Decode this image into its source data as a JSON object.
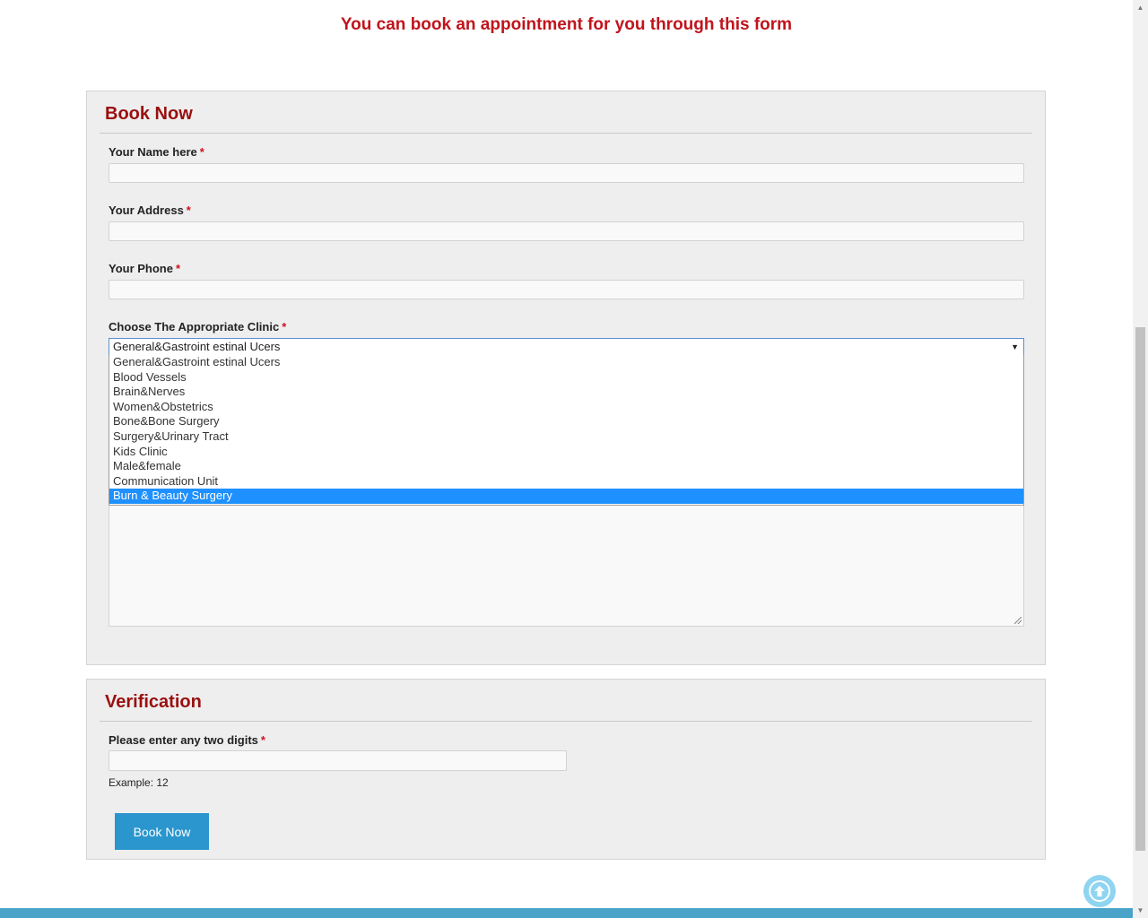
{
  "header": {
    "intro_text": "You can book an appointment for you through this form"
  },
  "book_panel": {
    "title": "Book Now",
    "fields": {
      "name_label": "Your Name here",
      "address_label": "Your Address",
      "phone_label": "Your Phone",
      "clinic_label": "Choose The Appropriate Clinic"
    },
    "required_marker": "*",
    "clinic_select": {
      "selected_value": "General&Gastroint estinal Ucers",
      "arrow_icon": "triangle-down-icon",
      "options": [
        "General&Gastroint estinal Ucers",
        "Blood Vessels",
        "Brain&Nerves",
        "Women&Obstetrics",
        "Bone&Bone Surgery",
        "Surgery&Urinary Tract",
        "Kids Clinic",
        "Male&female",
        "Communication Unit",
        "Burn & Beauty Surgery"
      ],
      "highlighted_option": "Burn & Beauty Surgery"
    }
  },
  "verify_panel": {
    "title": "Verification",
    "digits_label": "Please enter any two digits",
    "help_text": "Example: 12",
    "submit_label": "Book Now"
  },
  "colors": {
    "heading_red": "#9a0f0f",
    "intro_red": "#c0141c",
    "button_blue": "#2b96cd",
    "highlight_blue": "#1e90ff",
    "footer_blue": "#4aa3c9"
  }
}
